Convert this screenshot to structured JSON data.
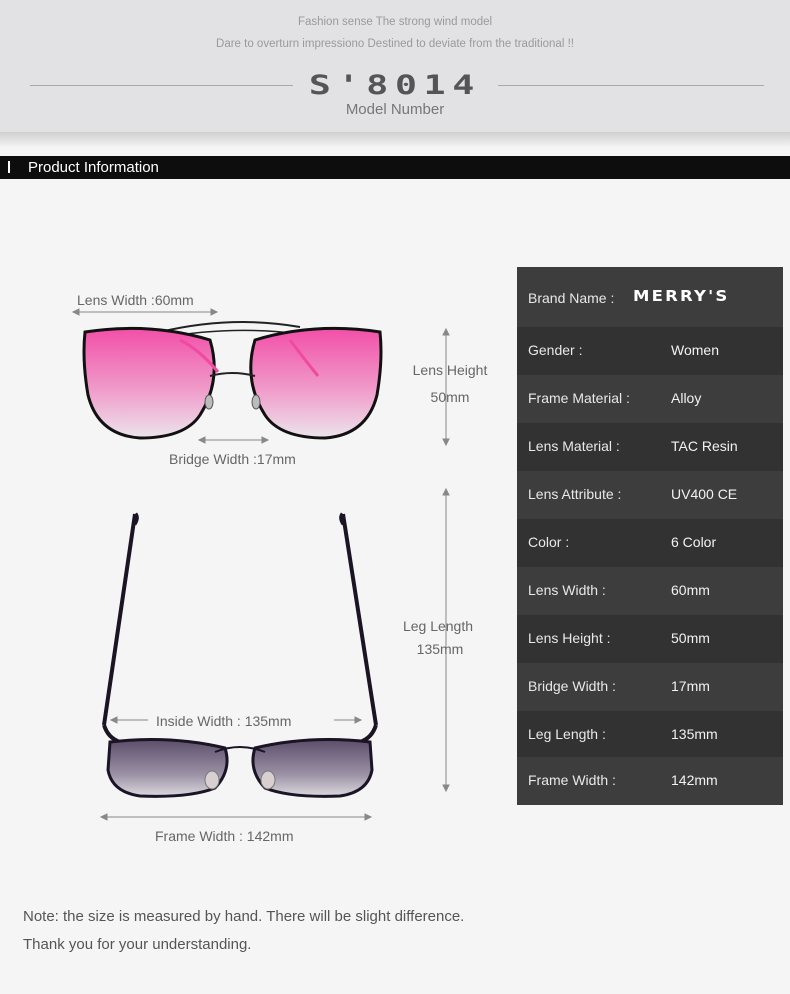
{
  "header": {
    "tagline_1": "Fashion sense The strong wind model",
    "tagline_2": "Dare to overturn impressiono Destined to deviate from the traditional !!",
    "model_number": "S'8014",
    "model_label": "Model Number"
  },
  "section": {
    "title": "Product Information"
  },
  "diagram": {
    "lens_width": "Lens Width :60mm",
    "lens_height_1": "Lens Height",
    "lens_height_2": "50mm",
    "bridge_width": "Bridge Width :17mm",
    "leg_length_1": "Leg Length",
    "leg_length_2": "135mm",
    "inside_width": "Inside  Width : 135mm",
    "frame_width": "Frame Width : 142mm"
  },
  "specs": {
    "brand_key": "Brand Name :",
    "brand_value": "MERRY'S",
    "rows": [
      {
        "key": "Gender :",
        "value": "Women"
      },
      {
        "key": "Frame Material :",
        "value": "Alloy"
      },
      {
        "key": "Lens Material :",
        "value": "TAC Resin"
      },
      {
        "key": "Lens Attribute :",
        "value": "UV400 CE"
      },
      {
        "key": "Color :",
        "value": "6 Color"
      },
      {
        "key": "Lens Width :",
        "value": "60mm"
      },
      {
        "key": "Lens Height :",
        "value": "50mm"
      },
      {
        "key": "Bridge Width :",
        "value": "17mm"
      },
      {
        "key": "Leg Length :",
        "value": "135mm"
      },
      {
        "key": "Frame Width :",
        "value": "142mm"
      }
    ]
  },
  "note": {
    "line_1": "Note: the size is measured by hand. There will be slight difference.",
    "line_2": "Thank you for your understanding."
  },
  "colors": {
    "lens_top": "#f24fa8",
    "lens_bottom": "#e9dde8",
    "dark_lens_top": "#6a5a78",
    "dark_lens_bottom": "#d8d4da",
    "table_bg": "#323232",
    "table_alt": "#3d3d3d"
  }
}
